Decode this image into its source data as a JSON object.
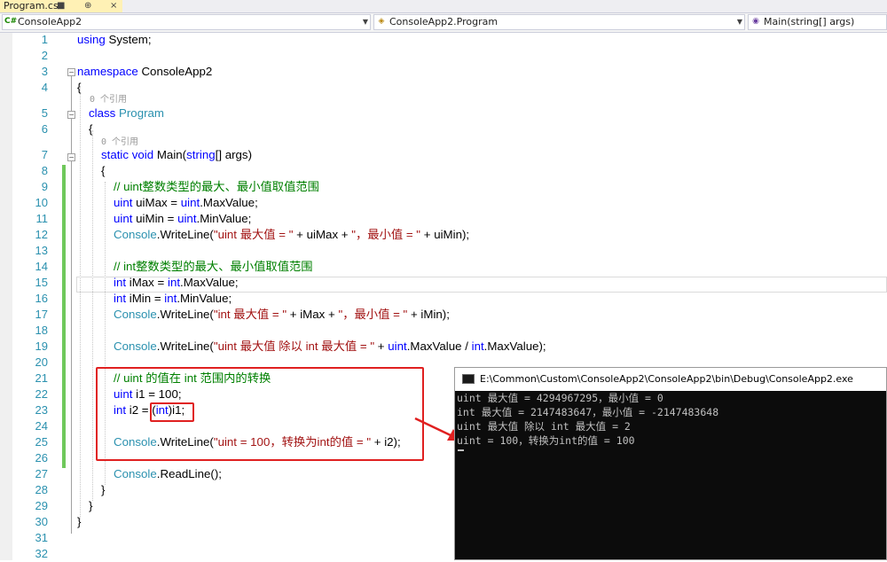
{
  "tab": {
    "title": "Program.cs",
    "pin": "⊕",
    "close": "×"
  },
  "nav": {
    "project": "ConsoleApp2",
    "class": "ConsoleApp2.Program",
    "member": "Main(string[] args)",
    "project_icon": "C#",
    "class_icon": "◈",
    "member_icon": "◉"
  },
  "editor": {
    "line_numbers": [
      "1",
      "2",
      "3",
      "4",
      "5",
      "6",
      "7",
      "8",
      "9",
      "10",
      "11",
      "12",
      "13",
      "14",
      "15",
      "16",
      "17",
      "18",
      "19",
      "20",
      "21",
      "22",
      "23",
      "24",
      "25",
      "26",
      "27",
      "28",
      "29",
      "30",
      "31",
      "32"
    ],
    "codelens": [
      "0 个引用",
      "0 个引用"
    ],
    "lines": [
      [
        {
          "t": "using",
          "c": "kw"
        },
        {
          "t": " System;"
        }
      ],
      [],
      [
        {
          "t": "namespace",
          "c": "kw"
        },
        {
          "t": " ConsoleApp2"
        }
      ],
      [
        {
          "t": "{"
        }
      ],
      [
        {
          "t": "class",
          "c": "kw"
        },
        {
          "t": " "
        },
        {
          "t": "Program",
          "c": "ty"
        }
      ],
      [
        {
          "t": "{"
        }
      ],
      [
        {
          "t": "static",
          "c": "kw"
        },
        {
          "t": " "
        },
        {
          "t": "void",
          "c": "kw"
        },
        {
          "t": " Main("
        },
        {
          "t": "string",
          "c": "kw"
        },
        {
          "t": "[] args)"
        }
      ],
      [
        {
          "t": "{"
        }
      ],
      [
        {
          "t": "// uint整数类型的最大、最小值取值范围",
          "c": "cm"
        }
      ],
      [
        {
          "t": "uint",
          "c": "kw"
        },
        {
          "t": " uiMax = "
        },
        {
          "t": "uint",
          "c": "kw"
        },
        {
          "t": ".MaxValue;"
        }
      ],
      [
        {
          "t": "uint",
          "c": "kw"
        },
        {
          "t": " uiMin = "
        },
        {
          "t": "uint",
          "c": "kw"
        },
        {
          "t": ".MinValue;"
        }
      ],
      [
        {
          "t": "Console",
          "c": "ty"
        },
        {
          "t": ".WriteLine("
        },
        {
          "t": "\"uint 最大值 = \"",
          "c": "st"
        },
        {
          "t": " + uiMax + "
        },
        {
          "t": "\"，最小值 = \"",
          "c": "st"
        },
        {
          "t": " + uiMin);"
        }
      ],
      [],
      [
        {
          "t": "// int整数类型的最大、最小值取值范围",
          "c": "cm"
        }
      ],
      [
        {
          "t": "int",
          "c": "kw"
        },
        {
          "t": " iMax = "
        },
        {
          "t": "int",
          "c": "kw"
        },
        {
          "t": ".MaxValue;"
        }
      ],
      [
        {
          "t": "int",
          "c": "kw"
        },
        {
          "t": " iMin = "
        },
        {
          "t": "int",
          "c": "kw"
        },
        {
          "t": ".MinValue;"
        }
      ],
      [
        {
          "t": "Console",
          "c": "ty"
        },
        {
          "t": ".WriteLine("
        },
        {
          "t": "\"int 最大值 = \"",
          "c": "st"
        },
        {
          "t": " + iMax + "
        },
        {
          "t": "\"，最小值 = \"",
          "c": "st"
        },
        {
          "t": " + iMin);"
        }
      ],
      [],
      [
        {
          "t": "Console",
          "c": "ty"
        },
        {
          "t": ".WriteLine("
        },
        {
          "t": "\"uint 最大值 除以 int 最大值 = \"",
          "c": "st"
        },
        {
          "t": " + "
        },
        {
          "t": "uint",
          "c": "kw"
        },
        {
          "t": ".MaxValue / "
        },
        {
          "t": "int",
          "c": "kw"
        },
        {
          "t": ".MaxValue);"
        }
      ],
      [],
      [
        {
          "t": "// uint 的值在 int 范围内的转换",
          "c": "cm"
        }
      ],
      [
        {
          "t": "uint",
          "c": "kw"
        },
        {
          "t": " i1 = 100;"
        }
      ],
      [
        {
          "t": "int",
          "c": "kw"
        },
        {
          "t": " i2 = ("
        },
        {
          "t": "int",
          "c": "kw"
        },
        {
          "t": ")i1;"
        }
      ],
      [],
      [
        {
          "t": "Console",
          "c": "ty"
        },
        {
          "t": ".WriteLine("
        },
        {
          "t": "\"uint = 100，转换为int的值 = \"",
          "c": "st"
        },
        {
          "t": " + i2);"
        }
      ],
      [],
      [
        {
          "t": "Console",
          "c": "ty"
        },
        {
          "t": ".ReadLine();"
        }
      ],
      [
        {
          "t": "}"
        }
      ],
      [
        {
          "t": "}"
        }
      ],
      [
        {
          "t": "}"
        }
      ],
      [],
      []
    ]
  },
  "console": {
    "title": "E:\\Common\\Custom\\ConsoleApp2\\ConsoleApp2\\bin\\Debug\\ConsoleApp2.exe",
    "lines": [
      "uint 最大值 = 4294967295，最小值 = 0",
      "int 最大值 = 2147483647，最小值 = -2147483648",
      "uint 最大值 除以 int 最大值 = 2",
      "uint = 100，转换为int的值 = 100"
    ]
  }
}
